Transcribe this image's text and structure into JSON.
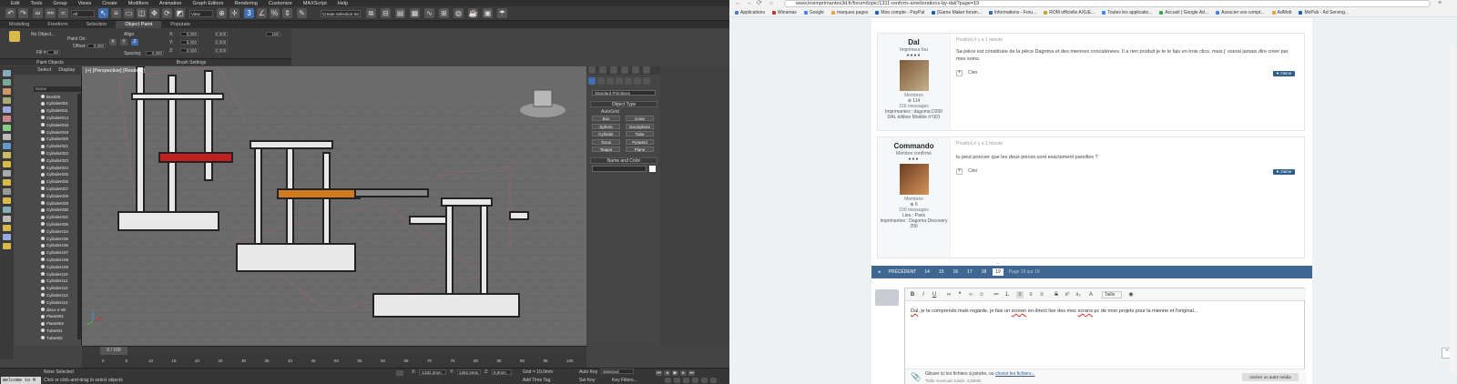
{
  "max": {
    "menu": [
      "Edit",
      "Tools",
      "Group",
      "Views",
      "Create",
      "Modifiers",
      "Animation",
      "Graph Editors",
      "Rendering",
      "Customize",
      "MAXScript",
      "Help"
    ],
    "toolbar": {
      "filter": "All",
      "view": "View",
      "selset": "Create Selection Se"
    },
    "ribbon_tabs": [
      "Modeling",
      "Freeform",
      "Selection",
      "Object Paint",
      "Populate"
    ],
    "ribbon": {
      "no_object": "No Object...",
      "paint_on": "Paint On:",
      "offset_label": "Offset:",
      "offset_value": "0,000",
      "fill_label": "Fill #:",
      "fill_value": "50",
      "align": "Align",
      "spacing_label": "Spacing:",
      "spacing_value": "0,000",
      "x": "0,000",
      "y": "0,000",
      "z": "0,000",
      "scale": "100",
      "paint_objects": "Paint Objects",
      "brush_settings": "Brush Settings"
    },
    "scene": {
      "tabs": [
        "Select",
        "Display"
      ],
      "col_name": "Name",
      "items": [
        "Box026",
        "Cylinder001",
        "Cylinder011",
        "Cylinder014",
        "Cylinder018",
        "Cylinder019",
        "Cylinder020",
        "Cylinder021",
        "Cylinder022",
        "Cylinder023",
        "Cylinder024",
        "Cylinder025",
        "Cylinder026",
        "Cylinder027",
        "Cylinder028",
        "Cylinder029",
        "Cylinder030",
        "Cylinder031",
        "Cylinder036",
        "Cylinder104",
        "Cylinder105",
        "Cylinder106",
        "Cylinder107",
        "Cylinder108",
        "Cylinder109",
        "Cylinder110",
        "Cylinder111",
        "Cylinder112",
        "Cylinder113",
        "Cylinder114",
        "disco e-ink",
        "Plane001",
        "Plane002",
        "Tube001",
        "Tube002"
      ]
    },
    "viewport_label": "[+] [Perspective] [Realistic]",
    "command": {
      "dropdown": "Standard Primitives",
      "object_type": "Object Type",
      "autogrid": "AutoGrid",
      "prims": [
        "Box",
        "Cone",
        "Sphere",
        "GeoSphere",
        "Cylinder",
        "Tube",
        "Torus",
        "Pyramid",
        "Teapot",
        "Plane"
      ],
      "name_color": "Name and Color"
    },
    "timeline": {
      "frame": "0 / 100",
      "ticks": [
        "0",
        "5",
        "10",
        "15",
        "20",
        "25",
        "30",
        "35",
        "40",
        "45",
        "50",
        "55",
        "60",
        "65",
        "70",
        "75",
        "80",
        "85",
        "90",
        "95",
        "100"
      ]
    },
    "status": {
      "welcome": "Welcome to M",
      "none_selected": "None Selected",
      "hint": "Click or click-and-drag to select objects",
      "x": "-1332,2mm",
      "y": "1262,2mm",
      "z": "0,0mm",
      "grid": "Grid = 10,0mm",
      "autokey": "Auto Key",
      "selected": "Selected",
      "setkey": "Set Key",
      "keyfilters": "Key Filters...",
      "addtimetag": "Add Time Tag"
    }
  },
  "browser": {
    "url": "www.lesimprimantes3d.fr/forum/topic/1311-renforts-ameliorations-by-dal/?page=19",
    "bookmarks": [
      "Applications",
      "Winamax",
      "Google",
      "marques pages",
      "Mon compte - PayPal",
      "[Game Maker forum...",
      "Informations - Foru...",
      "ROM officielle AXUE...",
      "Toutes les applicatio...",
      "Accueil | Google Ad...",
      "Associer vos compt...",
      "AdMob",
      "MoPub - Ad Serving..."
    ],
    "posts": [
      {
        "name": "Dal",
        "role": "Imprimeur fou",
        "dots": "●●●●",
        "group": "Membres",
        "rep": "114",
        "count": "216 messages",
        "extra1": "Imprimantes : dagoma D200",
        "extra2": "DAL édition Modèle n°001",
        "time": "Posté(e) il y a 1 minute",
        "text": "Sa pièce est constituée de la pièce Dagoma et des miennes concaténées. Il a rien produit je te le fais en trois clics. mais j' oserai jamais dire créer par mes soins.",
        "cite": "Citer",
        "like": "J'aime"
      },
      {
        "name": "Commando",
        "role": "Membre confirmé",
        "dots": "●●●",
        "group": "Membres",
        "rep": "6",
        "count": "100 messages",
        "extra1": "Lieu : Paris",
        "extra2": "Imprimantes : Dagoma Discovery 200",
        "time": "Posté(e) il y a 1 minute",
        "text": "tu peut prouver que les deux pièces sont exactement pareilles ?",
        "cite": "Citer",
        "like": "J'aime"
      }
    ],
    "pager": {
      "prev": "PRÉCÉDENT",
      "pages": [
        "14",
        "15",
        "16",
        "17",
        "18",
        "19"
      ],
      "current": "19",
      "info": "Page 19 sur 19"
    },
    "editor": {
      "style": "Taille",
      "text_parts": [
        "Dal",
        "je te comprends mais regarde. je fais un",
        "screen",
        "en direct live des mes",
        "ecrans",
        "pc de mon projets pour la mienne et l'original..."
      ],
      "attach": "Glisser ici les fichiers à joindre, ou",
      "attach_link": "choisir les fichiers...",
      "attach_size": "Taille maximale totale: 4,88MB",
      "insert": "Insérer un autre média"
    }
  }
}
